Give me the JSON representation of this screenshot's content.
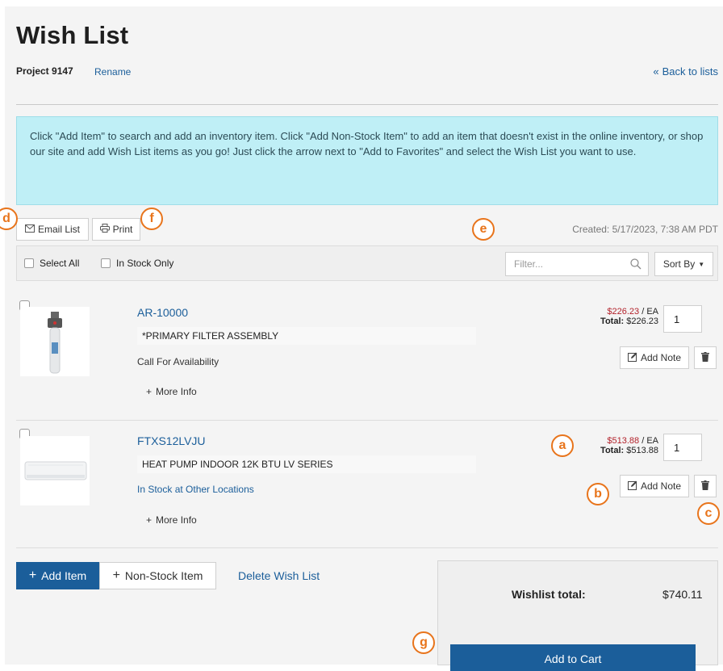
{
  "header": {
    "title": "Wish List",
    "project_name": "Project 9147",
    "rename_label": "Rename",
    "back_label": "Back to lists"
  },
  "info_text": "Click \"Add Item\" to search and add an inventory item. Click \"Add Non-Stock Item\" to add an item that doesn't exist in the online inventory, or shop our site and add Wish List items as you go! Just click the arrow next to \"Add to Favorites\" and select the Wish List you want to use.",
  "toolbar": {
    "email_label": "Email List",
    "print_label": "Print",
    "created_text": "Created: 5/17/2023, 7:38 AM PDT",
    "select_all_label": "Select All",
    "in_stock_only_label": "In Stock Only",
    "filter_placeholder": "Filter...",
    "sort_label": "Sort By"
  },
  "items": [
    {
      "sku": "AR-10000",
      "description": "*PRIMARY FILTER ASSEMBLY",
      "availability": "Call For Availability",
      "more_info": "More Info",
      "price": "$226.23",
      "unit": " / EA",
      "total_label": "Total:",
      "total_value": "$226.23",
      "quantity": "1",
      "add_note_label": "Add Note"
    },
    {
      "sku": "FTXS12LVJU",
      "description": "HEAT PUMP INDOOR 12K BTU LV SERIES",
      "availability": "In Stock at Other Locations",
      "more_info": "More Info",
      "price": "$513.88",
      "unit": " / EA",
      "total_label": "Total:",
      "total_value": "$513.88",
      "quantity": "1",
      "add_note_label": "Add Note"
    }
  ],
  "footer": {
    "add_item_label": "Add Item",
    "non_stock_label": "Non-Stock Item",
    "delete_label": "Delete Wish List",
    "wishlist_total_label": "Wishlist total:",
    "wishlist_total_value": "$740.11",
    "add_to_cart_label": "Add to Cart"
  },
  "badges": {
    "a": "a",
    "b": "b",
    "c": "c",
    "d": "d",
    "e": "e",
    "f": "f",
    "g": "g"
  },
  "colors": {
    "accent": "#1b5e9a",
    "price_red": "#b3232c",
    "info_bg": "#bfeff6",
    "badge": "#e8741b"
  },
  "icons": [
    "envelope-icon",
    "printer-icon",
    "search-icon",
    "caret-down-icon",
    "plus-icon",
    "edit-note-icon",
    "trash-icon",
    "double-chevron-left-icon"
  ]
}
